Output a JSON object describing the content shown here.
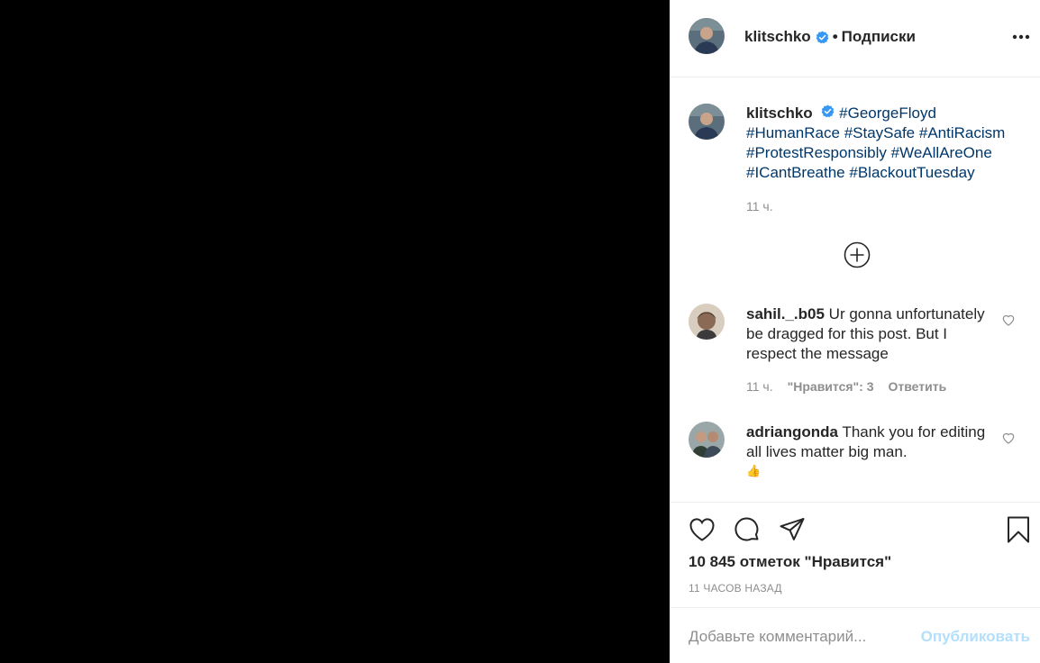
{
  "post": {
    "username": "klitschko",
    "separator": "•",
    "follow_label": "Подписки"
  },
  "caption": {
    "username": "klitschko",
    "tags": [
      "#GeorgeFloyd",
      "#HumanRace",
      "#StaySafe",
      "#AntiRacism",
      "#ProtestResponsibly",
      "#WeAllAreOne",
      "#ICantBreathe",
      "#BlackoutTuesday"
    ],
    "time": "11 ч."
  },
  "comments": [
    {
      "username": "sahil._.b05",
      "text": "Ur gonna unfortunately be dragged for this post. But I respect the message",
      "time": "11 ч.",
      "likes": "\"Нравится\": 3",
      "reply": "Ответить"
    },
    {
      "username": "adriangonda",
      "text": "Thank you for editing all lives matter big man.",
      "emoji": "👍"
    }
  ],
  "actions": {
    "icons": [
      "heart-icon",
      "comment-icon",
      "share-icon",
      "bookmark-icon"
    ],
    "likes_count": "10 845 отметок \"Нравится\"",
    "posted_ago": "11 ЧАСОВ НАЗАД"
  },
  "comment_box": {
    "placeholder": "Добавьте комментарий...",
    "publish_label": "Опубликовать"
  },
  "colors": {
    "media_bg": "#000000",
    "tag": "#00376b",
    "publish_disabled": "#b2dffc",
    "verified": "#3897f0",
    "secondary_text": "#8e8e8e"
  }
}
